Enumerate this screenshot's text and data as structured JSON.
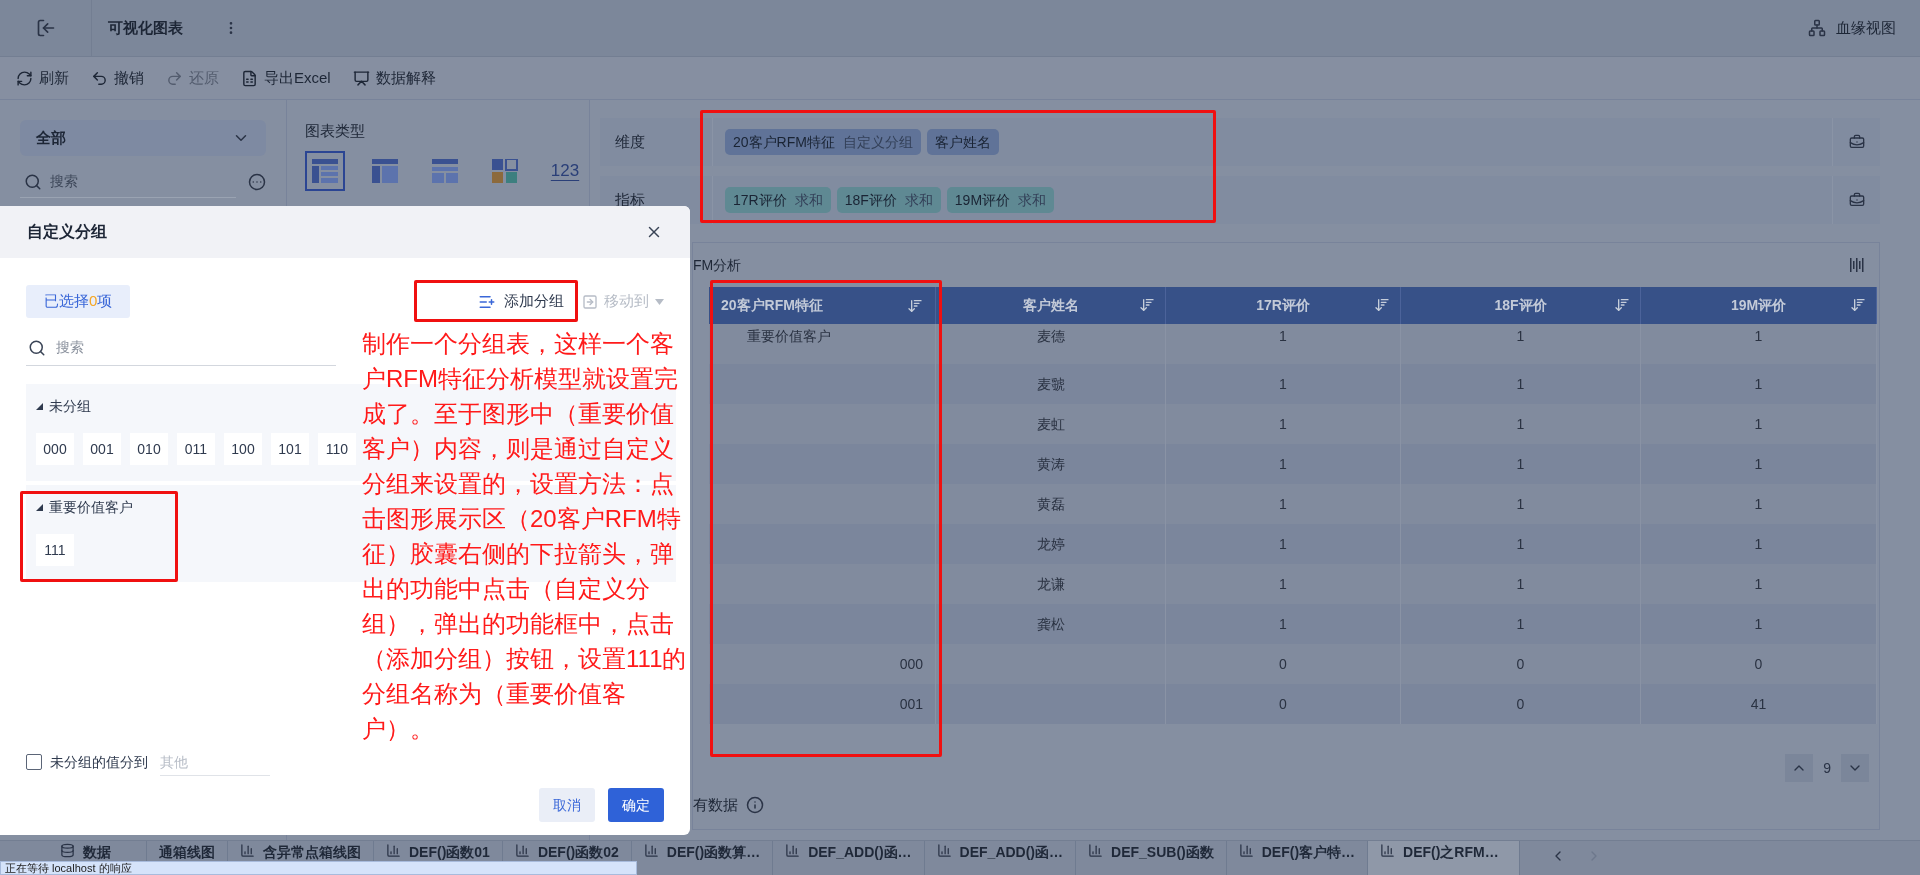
{
  "topbar": {
    "title": "可视化图表",
    "lineage": "血缘视图"
  },
  "toolbar": [
    {
      "kind": "refresh",
      "label": "刷新",
      "disabled": false
    },
    {
      "kind": "undo",
      "label": "撤销",
      "disabled": false
    },
    {
      "kind": "redo",
      "label": "还原",
      "disabled": true
    },
    {
      "kind": "excel",
      "label": "导出Excel",
      "disabled": false
    },
    {
      "kind": "explain",
      "label": "数据解释",
      "disabled": false
    }
  ],
  "field_panel": {
    "scope": "全部",
    "search_placeholder": "搜索"
  },
  "chart_types": {
    "title": "图表类型",
    "items": [
      {
        "kind": "table",
        "selected": true
      },
      {
        "kind": "cross",
        "selected": false
      },
      {
        "kind": "list",
        "selected": false
      },
      {
        "kind": "grid",
        "selected": false
      },
      {
        "kind": "number",
        "label": "123",
        "selected": false
      }
    ]
  },
  "shelves": [
    {
      "label": "维度",
      "pills": [
        {
          "kind": "dimension",
          "name": "20客户RFM特征",
          "note": "自定义分组"
        },
        {
          "kind": "dimension",
          "name": "客户姓名"
        }
      ]
    },
    {
      "label": "指标",
      "pills": [
        {
          "kind": "measure",
          "name": "17R评价",
          "note": "求和"
        },
        {
          "kind": "measure",
          "name": "18F评价",
          "note": "求和"
        },
        {
          "kind": "measure",
          "name": "19M评价",
          "note": "求和"
        }
      ]
    }
  ],
  "chart": {
    "title": "FM分析",
    "columns": [
      "20客户RFM特征",
      "客户姓名",
      "17R评价",
      "18F评价",
      "19M评价"
    ],
    "rows": [
      {
        "kind": "group",
        "c1": "重要价值客户",
        "c2": "麦德",
        "c3": "1",
        "c4": "1",
        "c5": "1"
      },
      {
        "kind": "group",
        "c2": "麦虢",
        "c3": "1",
        "c4": "1",
        "c5": "1"
      },
      {
        "kind": "group",
        "c2": "麦虹",
        "c3": "1",
        "c4": "1",
        "c5": "1"
      },
      {
        "kind": "group",
        "c2": "黄涛",
        "c3": "1",
        "c4": "1",
        "c5": "1"
      },
      {
        "kind": "group",
        "c2": "黄磊",
        "c3": "1",
        "c4": "1",
        "c5": "1"
      },
      {
        "kind": "group",
        "c2": "龙婷",
        "c3": "1",
        "c4": "1",
        "c5": "1"
      },
      {
        "kind": "group",
        "c2": "龙谦",
        "c3": "1",
        "c4": "1",
        "c5": "1"
      },
      {
        "kind": "group",
        "c2": "龚松",
        "c3": "1",
        "c4": "1",
        "c5": "1"
      },
      {
        "kind": "value",
        "c1": "000",
        "c3": "0",
        "c4": "0",
        "c5": "0"
      },
      {
        "kind": "value",
        "c1": "001",
        "c3": "0",
        "c4": "0",
        "c5": "41"
      }
    ],
    "page": "9",
    "footer": "有数据"
  },
  "dialog": {
    "title": "自定义分组",
    "selected_prefix": "已选择",
    "selected_count": "0",
    "selected_suffix": "项",
    "add_group": "添加分组",
    "move_to": {
      "label": "移动到",
      "disabled": true
    },
    "search_placeholder": "搜索",
    "groups": [
      {
        "name": "未分组",
        "expanded": true,
        "values": [
          "000",
          "001",
          "010",
          "011",
          "100",
          "101",
          "110"
        ]
      },
      {
        "name": "重要价值客户",
        "expanded": true,
        "values": [
          "111"
        ]
      }
    ],
    "ungrouped_option": {
      "label": "未分组的值分到",
      "checked": false,
      "placeholder": "其他"
    },
    "buttons": [
      {
        "kind": "secondary",
        "label": "取消"
      },
      {
        "kind": "primary",
        "label": "确定"
      }
    ]
  },
  "annotation": {
    "text": "制作一个分组表，这样一个客户RFM特征分析模型就设置完成了。至于图形中（重要价值客户）内容，则是通过自定义分组来设置的，设置方法：点击图形展示区（20客户RFM特征）胶囊右侧的下拉箭头，弹出的功能中点击（自定义分组），弹出的功能框中，点击（添加分组）按钮，设置111的分组名称为（重要价值客户）。"
  },
  "tabs": [
    {
      "kind": "data",
      "label": "数据",
      "selected": false
    },
    {
      "kind": "plain",
      "label": "通箱线图",
      "selected": false
    },
    {
      "kind": "chart",
      "label": "含异常点箱线图",
      "selected": false
    },
    {
      "kind": "chart",
      "label": "DEF()函数01",
      "selected": false
    },
    {
      "kind": "chart",
      "label": "DEF()函数02",
      "selected": false
    },
    {
      "kind": "chart",
      "label": "DEF()函数算…",
      "selected": false
    },
    {
      "kind": "chart",
      "label": "DEF_ADD()函…",
      "selected": false
    },
    {
      "kind": "chart",
      "label": "DEF_ADD()函…",
      "selected": false
    },
    {
      "kind": "chart",
      "label": "DEF_SUB()函数",
      "selected": false
    },
    {
      "kind": "chart",
      "label": "DEF()客户特…",
      "selected": false
    },
    {
      "kind": "chart",
      "label": "DEF()之RFM…",
      "selected": true
    }
  ],
  "status": "正在等待 localhost 的响应"
}
